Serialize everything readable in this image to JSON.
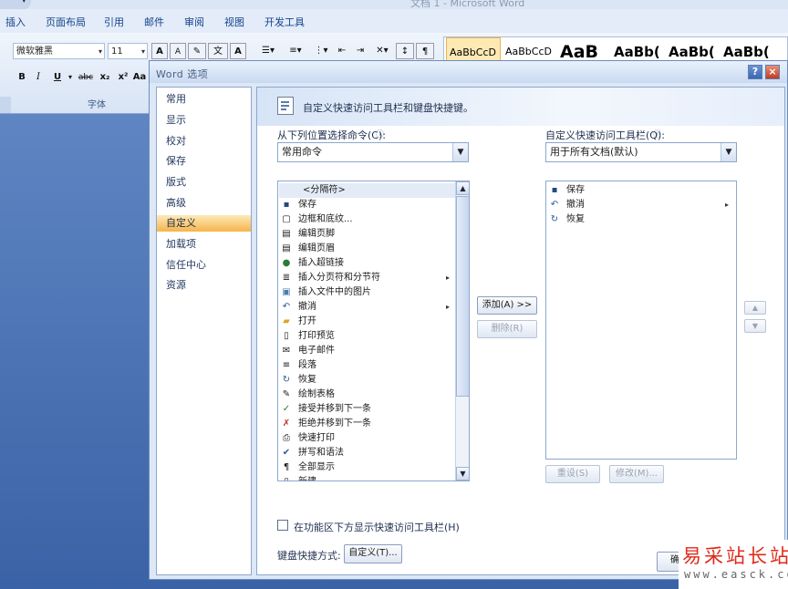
{
  "window": {
    "title": "文档 1 - Microsoft Word"
  },
  "ribbon": {
    "tabs": [
      "插入",
      "页面布局",
      "引用",
      "邮件",
      "审阅",
      "视图",
      "开发工具"
    ],
    "font_name": "微软雅黑",
    "font_size": "11",
    "grow_font": "A",
    "shrink_font": "A",
    "bold": "B",
    "italic": "I",
    "underline": "U",
    "strike": "abc",
    "subscript": "x₂",
    "superscript": "x²",
    "change_case": "Aa",
    "font_group_label": "字体",
    "styles": [
      "AaBbCcD",
      "AaBbCcD",
      "AaB",
      "AaBb(",
      "AaBb(",
      "AaBb("
    ]
  },
  "dialog": {
    "title": "Word 选项",
    "help": "?",
    "close": "×",
    "nav": [
      "常用",
      "显示",
      "校对",
      "保存",
      "版式",
      "高级",
      "自定义",
      "加载项",
      "信任中心",
      "资源"
    ],
    "selected_nav": "自定义",
    "header_text": "自定义快速访问工具栏和键盘快捷键。",
    "choose_label": "从下列位置选择命令(C):",
    "choose_value": "常用命令",
    "customize_label": "自定义快速访问工具栏(Q):",
    "customize_value": "用于所有文档(默认)",
    "commands": [
      {
        "label": "<分隔符>",
        "icon": "separator"
      },
      {
        "label": "保存",
        "icon": "save-icon"
      },
      {
        "label": "边框和底纹...",
        "icon": "border-icon"
      },
      {
        "label": "编辑页脚",
        "icon": "footer-icon"
      },
      {
        "label": "编辑页眉",
        "icon": "header-icon"
      },
      {
        "label": "插入超链接",
        "icon": "hyperlink-icon"
      },
      {
        "label": "插入分页符和分节符",
        "icon": "page-break-icon",
        "submenu": true
      },
      {
        "label": "插入文件中的图片",
        "icon": "picture-icon"
      },
      {
        "label": "撤消",
        "icon": "undo-icon",
        "submenu": true
      },
      {
        "label": "打开",
        "icon": "open-folder-icon"
      },
      {
        "label": "打印预览",
        "icon": "print-preview-icon"
      },
      {
        "label": "电子邮件",
        "icon": "email-icon"
      },
      {
        "label": "段落",
        "icon": "paragraph-icon"
      },
      {
        "label": "恢复",
        "icon": "redo-icon"
      },
      {
        "label": "绘制表格",
        "icon": "draw-table-icon"
      },
      {
        "label": "接受并移到下一条",
        "icon": "accept-change-icon"
      },
      {
        "label": "拒绝并移到下一条",
        "icon": "reject-change-icon"
      },
      {
        "label": "快速打印",
        "icon": "quick-print-icon"
      },
      {
        "label": "拼写和语法",
        "icon": "spelling-icon"
      },
      {
        "label": "全部显示",
        "icon": "show-all-icon"
      },
      {
        "label": "新建",
        "icon": "new-document-icon"
      }
    ],
    "toolbar_items": [
      {
        "label": "保存",
        "icon": "save-icon"
      },
      {
        "label": "撤消",
        "icon": "undo-icon",
        "submenu": true
      },
      {
        "label": "恢复",
        "icon": "redo-icon"
      }
    ],
    "add_button": "添加(A) >>",
    "remove_button": "删除(R)",
    "reset_button": "重设(S)",
    "modify_button": "修改(M)...",
    "show_below_label": "在功能区下方显示快速访问工具栏(H)",
    "keyboard_label": "键盘快捷方式:",
    "keyboard_button": "自定义(T)...",
    "ok_button": "确"
  },
  "watermark": {
    "text": "易采站长站",
    "url": "www.easck.com"
  },
  "colors": {
    "accent_selection": "#f6b44a",
    "title_text": "#4a5f83",
    "watermark_red": "#e02a1a"
  }
}
